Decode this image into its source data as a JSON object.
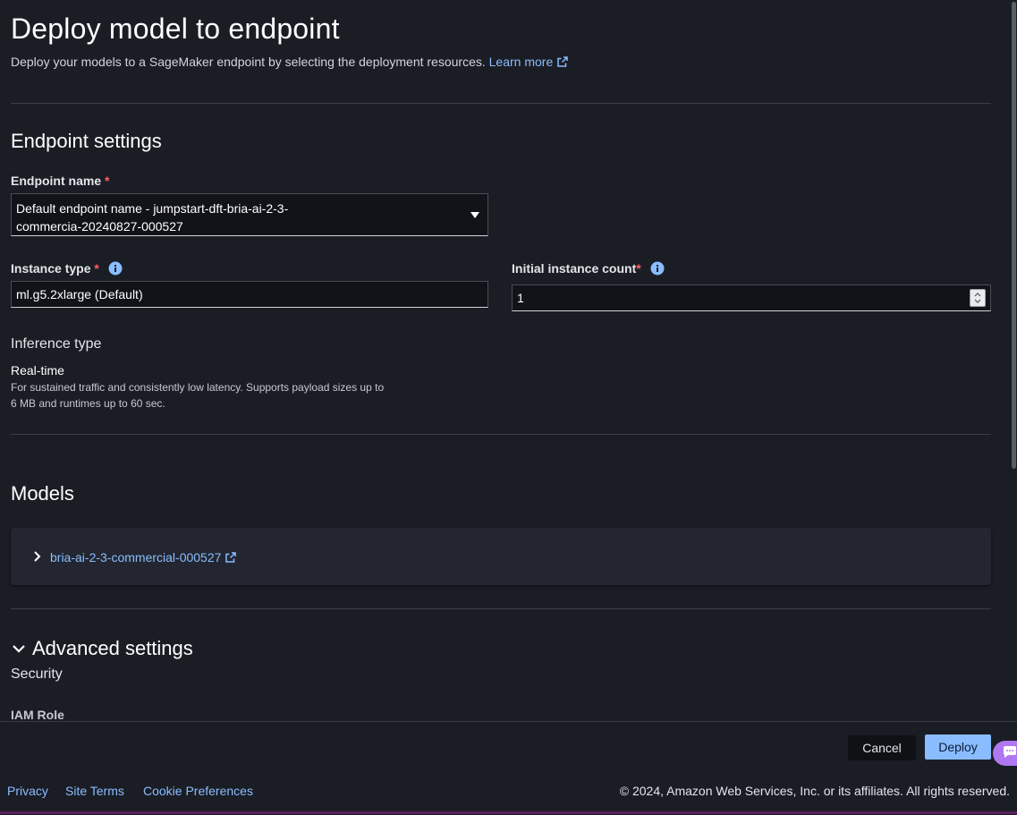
{
  "header": {
    "title": "Deploy model to endpoint",
    "subtitle": "Deploy your models to a SageMaker endpoint by selecting the deployment resources.",
    "learn_more": "Learn more"
  },
  "endpoint_settings": {
    "heading": "Endpoint settings",
    "endpoint_name": {
      "label": "Endpoint name",
      "required_mark": "*",
      "value": "Default endpoint name - jumpstart-dft-bria-ai-2-3-commercia-20240827-000527"
    },
    "instance_type": {
      "label": "Instance type",
      "required_mark": "*",
      "value": "ml.g5.2xlarge (Default)"
    },
    "initial_instance_count": {
      "label": "Initial instance count",
      "required_mark": "*",
      "value": "1"
    },
    "inference_type": {
      "heading": "Inference type",
      "option": "Real-time",
      "description": "For sustained traffic and consistently low latency. Supports payload sizes up to 6 MB and runtimes up to 60 sec."
    }
  },
  "models": {
    "heading": "Models",
    "items": [
      {
        "name": "bria-ai-2-3-commercial-000527"
      }
    ]
  },
  "advanced_settings": {
    "heading": "Advanced settings",
    "security": "Security",
    "iam_role": "IAM Role"
  },
  "actions": {
    "cancel": "Cancel",
    "deploy": "Deploy"
  },
  "footer": {
    "privacy": "Privacy",
    "site_terms": "Site Terms",
    "cookie_preferences": "Cookie Preferences",
    "copyright": "© 2024, Amazon Web Services, Inc. or its affiliates. All rights reserved."
  },
  "colors": {
    "background": "#1b1d25",
    "link": "#89bdff",
    "required": "#ff5d64",
    "primary_button": "#89bdff"
  },
  "icons": [
    "external-link-icon",
    "info-icon",
    "caret-down-icon",
    "chevron-right-icon",
    "chevron-down-icon",
    "chat-icon"
  ]
}
